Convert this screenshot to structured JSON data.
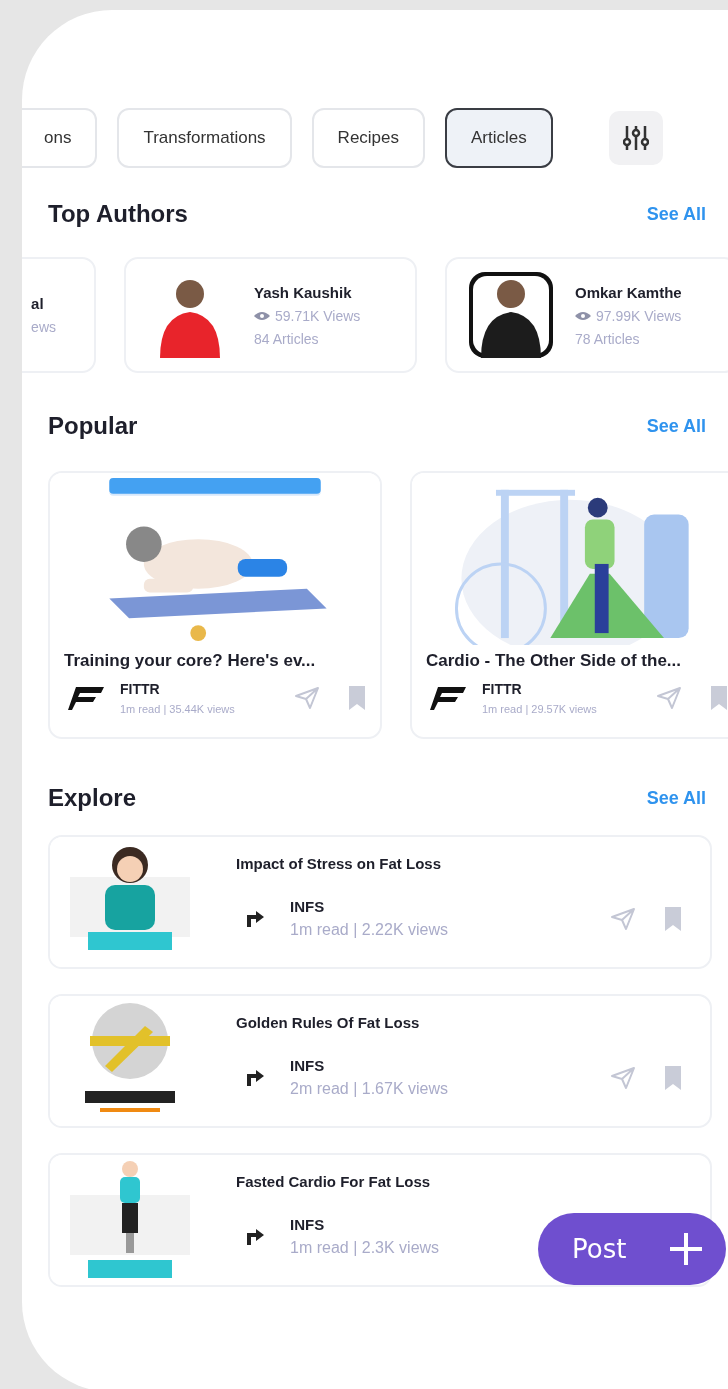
{
  "filters": [
    {
      "label": "ons",
      "selected": false
    },
    {
      "label": "Transformations",
      "selected": false
    },
    {
      "label": "Recipes",
      "selected": false
    },
    {
      "label": "Articles",
      "selected": true
    }
  ],
  "top_authors": {
    "title": "Top Authors",
    "see_all": "See All",
    "authors": [
      {
        "kind": "clipped",
        "name": "al",
        "views": "ews"
      },
      {
        "kind": "full",
        "name": "Yash Kaushik",
        "views": "59.71K Views",
        "articles": "84 Articles"
      },
      {
        "kind": "full",
        "name": "Omkar Kamthe",
        "views": "97.99K Views",
        "articles": "78 Articles"
      }
    ]
  },
  "popular": {
    "title": "Popular",
    "see_all": "See All",
    "cards": [
      {
        "title": "Training your core? Here's ev...",
        "source": "FITTR",
        "meta": "1m read | 35.44K views"
      },
      {
        "title": "Cardio - The Other Side of the...",
        "source": "FITTR",
        "meta": "1m read | 29.57K views"
      }
    ]
  },
  "explore": {
    "title": "Explore",
    "see_all": "See All",
    "items": [
      {
        "title": "Impact of Stress on Fat Loss",
        "source": "INFS",
        "meta": "1m read | 2.22K views"
      },
      {
        "title": "Golden Rules Of Fat Loss",
        "source": "INFS",
        "meta": "2m read | 1.67K views"
      },
      {
        "title": "Fasted Cardio For Fat Loss",
        "source": "INFS",
        "meta": "1m read | 2.3K views"
      }
    ]
  },
  "post_button": {
    "label": "Post"
  }
}
